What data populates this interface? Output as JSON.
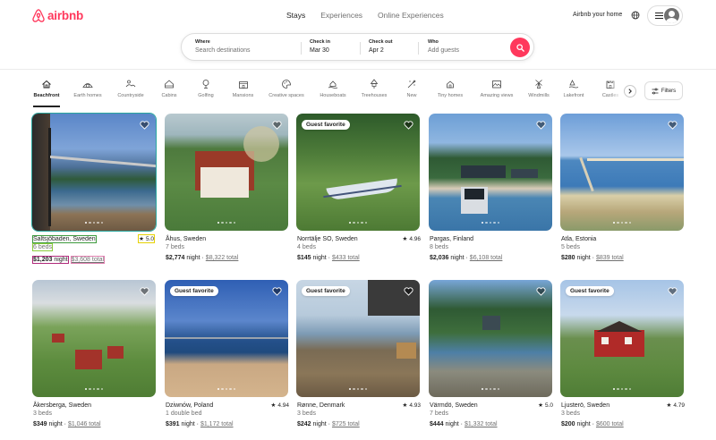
{
  "brand": {
    "name": "airbnb",
    "color": "#ff385c"
  },
  "header": {
    "tabs": [
      "Stays",
      "Experiences",
      "Online Experiences"
    ],
    "active_tab": "Stays",
    "host_link": "Airbnb your home",
    "globe_icon": "globe-icon",
    "menu_icon": "hamburger-icon",
    "avatar_icon": "user-avatar-icon"
  },
  "search": {
    "where": {
      "label": "Where",
      "placeholder": "Search destinations"
    },
    "checkin": {
      "label": "Check in",
      "value": "Mar 30"
    },
    "checkout": {
      "label": "Check out",
      "value": "Apr 2"
    },
    "who": {
      "label": "Who",
      "placeholder": "Add guests"
    },
    "button_icon": "search-icon"
  },
  "categories": [
    {
      "label": "Beachfront",
      "icon": "beachfront-icon",
      "active": true
    },
    {
      "label": "Earth homes",
      "icon": "earth-home-icon"
    },
    {
      "label": "Countryside",
      "icon": "countryside-icon"
    },
    {
      "label": "Cabins",
      "icon": "cabin-icon"
    },
    {
      "label": "Golfing",
      "icon": "golf-icon"
    },
    {
      "label": "Mansions",
      "icon": "mansion-icon"
    },
    {
      "label": "Creative spaces",
      "icon": "palette-icon"
    },
    {
      "label": "Houseboats",
      "icon": "houseboat-icon"
    },
    {
      "label": "Treehouses",
      "icon": "treehouse-icon"
    },
    {
      "label": "New",
      "icon": "new-icon"
    },
    {
      "label": "Tiny homes",
      "icon": "tiny-home-icon"
    },
    {
      "label": "Amazing views",
      "icon": "view-icon"
    },
    {
      "label": "Windmills",
      "icon": "windmill-icon"
    },
    {
      "label": "Lakefront",
      "icon": "lakefront-icon"
    },
    {
      "label": "Castles",
      "icon": "castle-icon"
    }
  ],
  "filters_label": "Filters",
  "listings": [
    {
      "location": "Saltsjöbaden, Sweden",
      "rating": "5.0",
      "beds": "6 beds",
      "price": "$1,203",
      "night": "night",
      "total": "$3,608 total",
      "badge": ""
    },
    {
      "location": "Åhus, Sweden",
      "rating": "",
      "beds": "7 beds",
      "price": "$2,774",
      "night": "night",
      "total": "$8,322 total",
      "badge": ""
    },
    {
      "location": "Norrtälje SO, Sweden",
      "rating": "4.96",
      "beds": "4 beds",
      "price": "$145",
      "night": "night",
      "total": "$433 total",
      "badge": "Guest favorite"
    },
    {
      "location": "Pargas, Finland",
      "rating": "",
      "beds": "8 beds",
      "price": "$2,036",
      "night": "night",
      "total": "$6,108 total",
      "badge": ""
    },
    {
      "location": "Atla, Estonia",
      "rating": "",
      "beds": "5 beds",
      "price": "$280",
      "night": "night",
      "total": "$839 total",
      "badge": ""
    },
    {
      "location": "Åkersberga, Sweden",
      "rating": "",
      "beds": "3 beds",
      "price": "$349",
      "night": "night",
      "total": "$1,046 total",
      "badge": ""
    },
    {
      "location": "Dziwnów, Poland",
      "rating": "4.94",
      "beds": "1 double bed",
      "price": "$391",
      "night": "night",
      "total": "$1,172 total",
      "badge": "Guest favorite"
    },
    {
      "location": "Rønne, Denmark",
      "rating": "4.93",
      "beds": "3 beds",
      "price": "$242",
      "night": "night",
      "total": "$725 total",
      "badge": "Guest favorite"
    },
    {
      "location": "Värmdö, Sweden",
      "rating": "5.0",
      "beds": "7 beds",
      "price": "$444",
      "night": "night",
      "total": "$1,332 total",
      "badge": ""
    },
    {
      "location": "Ljusterö, Sweden",
      "rating": "4.79",
      "beds": "3 beds",
      "price": "$200",
      "night": "night",
      "total": "$600 total",
      "badge": "Guest favorite"
    }
  ]
}
